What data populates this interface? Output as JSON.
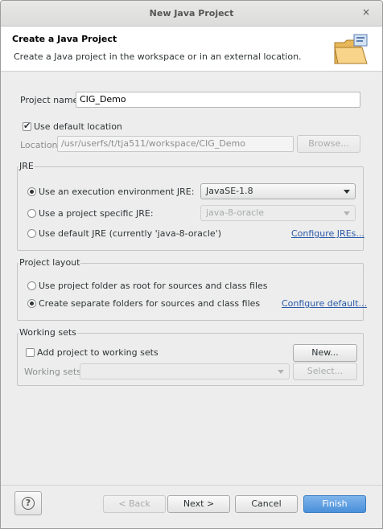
{
  "window": {
    "title": "New Java Project",
    "close_glyph": "×"
  },
  "header": {
    "title": "Create a Java Project",
    "description": "Create a Java project in the workspace or in an external location.",
    "icon": "java-project-folder-icon"
  },
  "project": {
    "name_label": "Project name:",
    "name_value": "CIG_Demo",
    "use_default_location_label": "Use default location",
    "use_default_location_checked": true,
    "location_label": "Location:",
    "location_value": "/usr/userfs/t/tja511/workspace/CIG_Demo",
    "browse_label": "Browse..."
  },
  "jre": {
    "group_title": "JRE",
    "option_env_label": "Use an execution environment JRE:",
    "option_env_value": "JavaSE-1.8",
    "option_specific_label": "Use a project specific JRE:",
    "option_specific_value": "java-8-oracle",
    "option_default_label": "Use default JRE (currently 'java-8-oracle')",
    "configure_link": "Configure JREs...",
    "selected": "env"
  },
  "layout": {
    "group_title": "Project layout",
    "option_root_label": "Use project folder as root for sources and class files",
    "option_separate_label": "Create separate folders for sources and class files",
    "configure_link": "Configure default...",
    "selected": "separate"
  },
  "working_sets": {
    "group_title": "Working sets",
    "add_label": "Add project to working sets",
    "add_checked": false,
    "new_label": "New...",
    "sets_label": "Working sets:",
    "sets_value": "",
    "select_label": "Select..."
  },
  "buttons": {
    "help_glyph": "?",
    "back": "< Back",
    "next": "Next >",
    "cancel": "Cancel",
    "finish": "Finish"
  },
  "colors": {
    "accent": "#4a90d9",
    "link": "#2a5aa8",
    "dialog_bg": "#ededed"
  }
}
